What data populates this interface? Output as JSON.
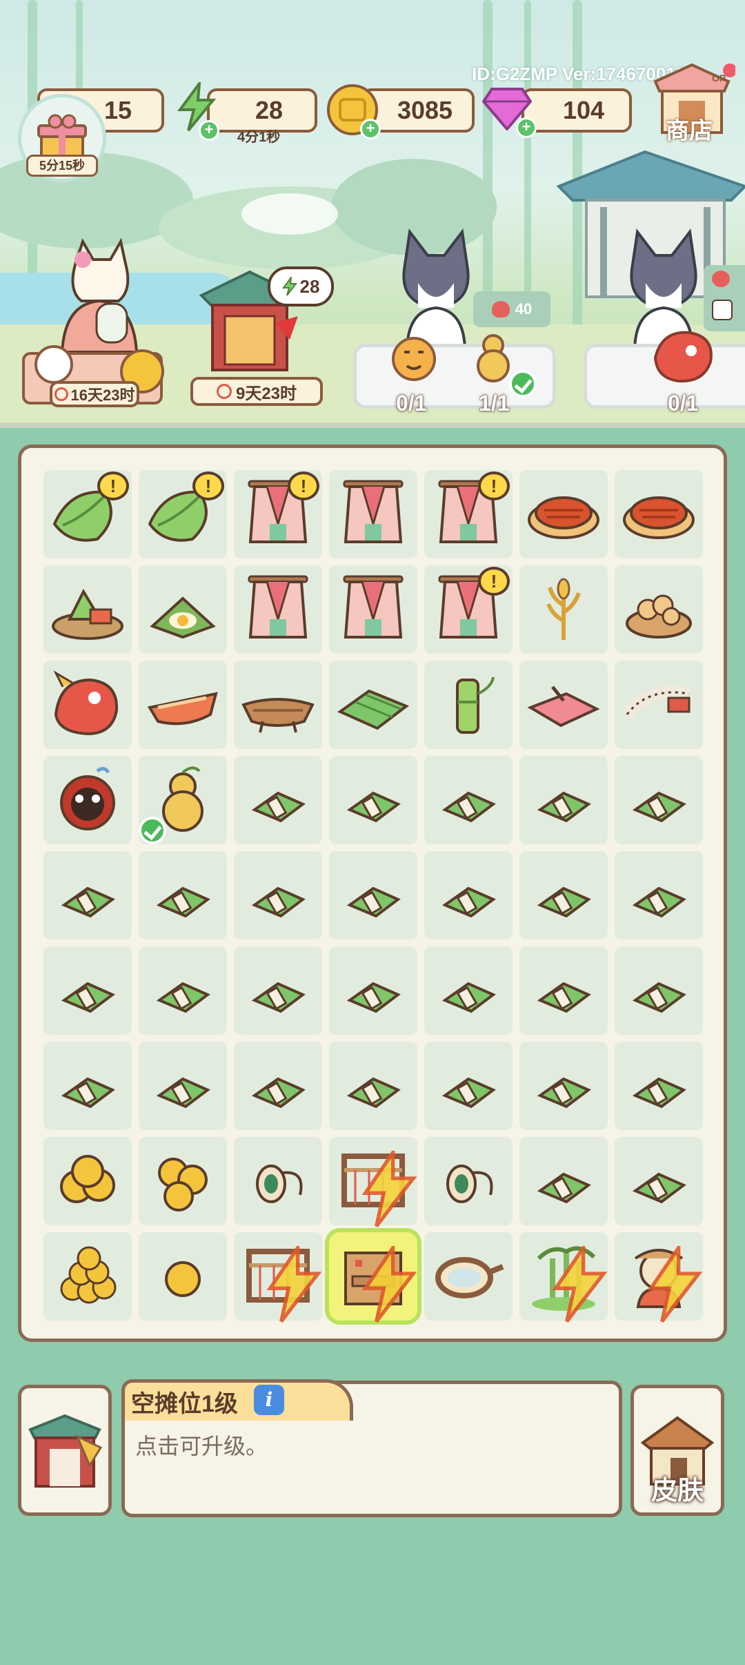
{
  "hud": {
    "level_value": "15",
    "energy_value": "28",
    "energy_timer": "4分1秒",
    "coins_value": "3085",
    "gems_value": "104",
    "gift_timer": "5分15秒",
    "shop_label": "商店",
    "shop_sign": "OP",
    "id_version": "ID:G2ZMP  Ver:174670013"
  },
  "scene": {
    "left_cat_timer": "16天23时",
    "pavilion_timer": "9天23时",
    "pavilion_bubble": "28",
    "offer_value": "40",
    "stall1_counts": [
      "0/1",
      "1/1"
    ],
    "stall2_count": "0/1"
  },
  "board": {
    "rows": [
      [
        "zongzi-leaf-icon",
        "zongzi-leaf-icon",
        "pink-robe-icon",
        "pink-robe-icon",
        "pink-robe-icon",
        "roast-pork-icon",
        "roast-pork-icon"
      ],
      [
        "zongzi-platter-icon",
        "zongzi-egg-icon",
        "pink-robe-icon",
        "pink-robe-icon",
        "pink-robe-icon",
        "wheat-icon",
        "peanuts-icon"
      ],
      [
        "dragon-head-icon",
        "dragon-boat-icon",
        "wooden-boat-icon",
        "leaf-bundle-icon",
        "bamboo-icon",
        "pink-cloth-icon",
        "tape-measure-icon"
      ],
      [
        "lion-mask-icon",
        "gourd-icon",
        "leaf-bundle-small-icon",
        "leaf-bundle-small-icon",
        "leaf-bundle-small-icon",
        "leaf-bundle-small-icon",
        "leaf-bundle-small-icon"
      ],
      [
        "leaf-bundle-small-icon",
        "leaf-bundle-small-icon",
        "leaf-bundle-small-icon",
        "leaf-bundle-small-icon",
        "leaf-bundle-small-icon",
        "leaf-bundle-small-icon",
        "leaf-bundle-small-icon"
      ],
      [
        "leaf-bundle-small-icon",
        "leaf-bundle-small-icon",
        "leaf-bundle-small-icon",
        "leaf-bundle-small-icon",
        "leaf-bundle-small-icon",
        "leaf-bundle-small-icon",
        "leaf-bundle-small-icon"
      ],
      [
        "leaf-bundle-small-icon",
        "leaf-bundle-small-icon",
        "leaf-bundle-small-icon",
        "leaf-bundle-small-icon",
        "leaf-bundle-small-icon",
        "leaf-bundle-small-icon",
        "leaf-bundle-small-icon"
      ],
      [
        "coins-pile-icon",
        "coins-three-icon",
        "thread-spool-icon",
        "loom-generator-icon",
        "thread-spool-icon",
        "leaf-bundle-small-icon",
        "leaf-bundle-small-icon"
      ],
      [
        "coins-heap-icon",
        "coin-single-icon",
        "loom-generator-icon",
        "empty-stall-icon",
        "mirror-icon",
        "bamboo-grove-generator-icon",
        "cat-vendor-generator-icon"
      ]
    ],
    "alerts": [
      [
        0,
        0
      ],
      [
        0,
        1
      ],
      [
        0,
        2
      ],
      [
        0,
        4
      ],
      [
        1,
        4
      ]
    ],
    "checks": [
      [
        3,
        1
      ]
    ],
    "bolts": [
      [
        7,
        3
      ],
      [
        8,
        2
      ],
      [
        8,
        3
      ],
      [
        8,
        5
      ],
      [
        8,
        6
      ]
    ],
    "selected": [
      8,
      3
    ]
  },
  "info": {
    "title": "空摊位1级",
    "icon_label": "i",
    "description": "点击可升级。"
  },
  "bottom": {
    "skin_label": "皮肤"
  }
}
